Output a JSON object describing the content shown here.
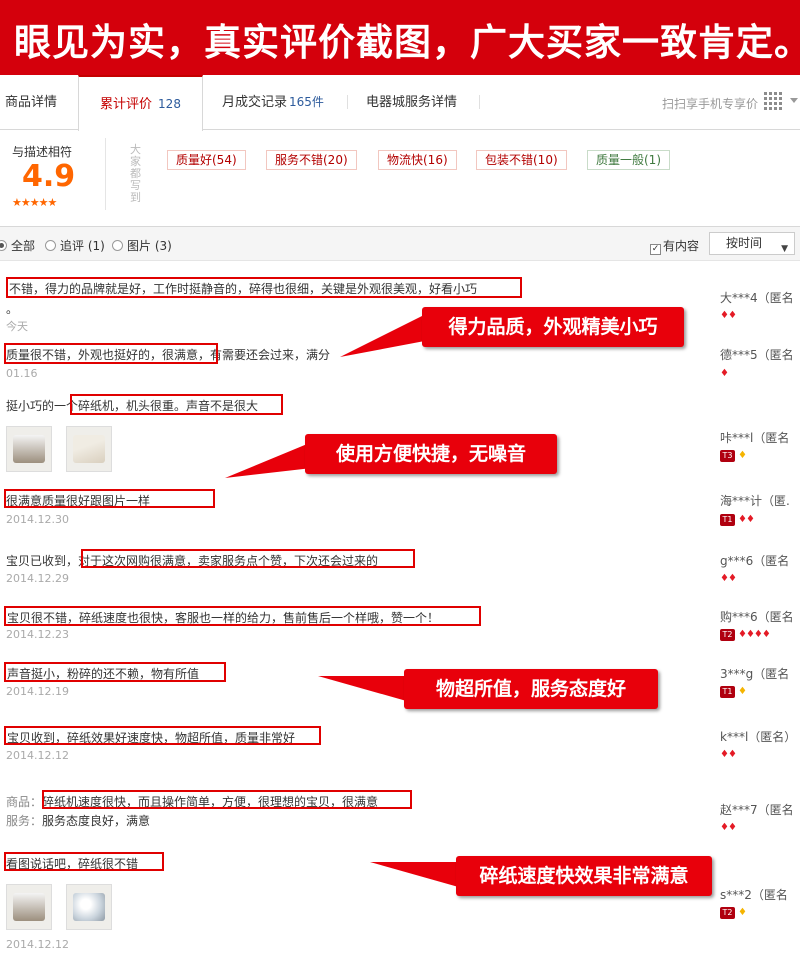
{
  "banner": {
    "text": "眼见为实，真实评价截图，广大买家一致肯定。"
  },
  "tabs": [
    {
      "label": "商品详情"
    },
    {
      "label": "累计评价",
      "count": "128"
    },
    {
      "label": "月成交记录",
      "count": "165件"
    },
    {
      "label": "电器城服务详情"
    }
  ],
  "scan_label": "扫扫享手机专享价",
  "summary": {
    "label": "与描述相符",
    "score": "4.9",
    "stars": "★★★★★",
    "vertical_text": "大家都写到",
    "tags": [
      {
        "label": "质量好(54)"
      },
      {
        "label": "服务不错(20)"
      },
      {
        "label": "物流快(16)"
      },
      {
        "label": "包装不错(10)"
      },
      {
        "label": "质量一般(1)"
      }
    ]
  },
  "filter": {
    "all": "全部",
    "followup": "追评 (1)",
    "images": "图片 (3)",
    "has_content": "有内容",
    "sort": "按时间"
  },
  "reviews": [
    {
      "text": "不错，得力的品牌就是好，工作时挺静音的，碎得也很细，关键是外观很美观，好看小巧",
      "extra": "。",
      "date": "今天",
      "user": "大***4（匿名",
      "badge": "♦♦"
    },
    {
      "text": "质量很不错，外观也挺好的，很满意",
      "rest": "，有需要还会过来，满分",
      "date": "01.16",
      "user": "德***5（匿名",
      "badge": "♦"
    },
    {
      "prefix": "挺小巧的一",
      "text": "个碎纸机，机头很重。声音不是很大",
      "user": "咔***l（匿名",
      "level": "T3",
      "badge": "♦"
    },
    {
      "text": "很满意质量很好跟图片一样",
      "date": "2014.12.30",
      "user": "海***计（匿.",
      "level": "T1",
      "badge": "♦♦"
    },
    {
      "prefix": "宝贝已收到，",
      "text": "对于这次网购很满意，卖家服务点个赞，下次还会过来的",
      "date": "2014.12.29",
      "user": "g***6（匿名",
      "badge": "♦♦"
    },
    {
      "text": "宝贝很不错，碎纸速度也很快，客服也一样的给力，售前售后一个样哦，赞一个！",
      "date": "2014.12.23",
      "user": "购***6（匿名",
      "level": "T2",
      "badge": "♦♦♦♦"
    },
    {
      "text": "声音挺小，粉碎的还不赖，物有所值",
      "date": "2014.12.19",
      "user": "3***g（匿名",
      "level": "T1",
      "badge": "♦"
    },
    {
      "text": "宝贝收到，碎纸效果好速度快，物超所值，质量非常好",
      "date": "2014.12.12",
      "user": "k***l（匿名）",
      "badge": "♦♦"
    },
    {
      "prefix": "商品：",
      "text": "碎纸机速度很快，而且操作简单，方便，很理想的宝贝，很满意",
      "service_prefix": "服务：",
      "service": "服务态度良好，满意",
      "user": "赵***7（匿名",
      "badge": "♦♦"
    },
    {
      "text": "看图说话吧，碎纸很不错",
      "date": "2014.12.12",
      "user": "s***2（匿名",
      "level": "T2",
      "badge": "♦"
    }
  ],
  "callouts": [
    {
      "text": "得力品质，外观精美小巧"
    },
    {
      "text": "使用方便快捷，无噪音"
    },
    {
      "text": "物超所值，服务态度好"
    },
    {
      "text": "碎纸速度快效果非常满意"
    }
  ],
  "colors": {
    "banner": "#d4000c",
    "highlight": "#e00000",
    "score": "#ff6600",
    "tab_active": "#c40000"
  }
}
